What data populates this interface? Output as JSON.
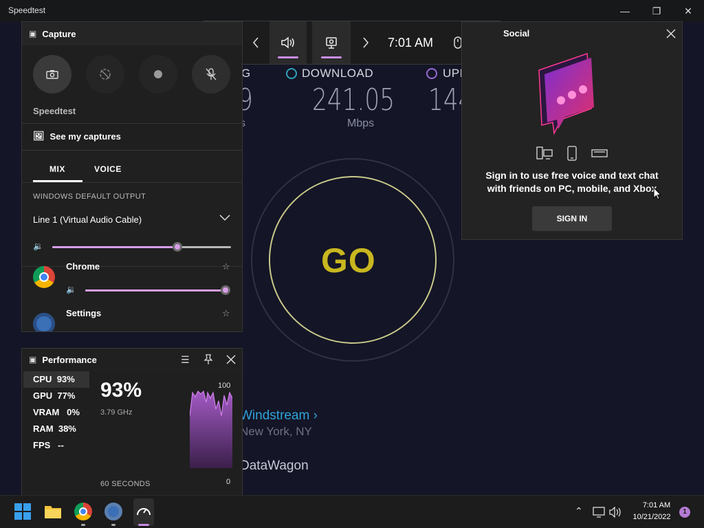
{
  "app": {
    "title": "Speedtest"
  },
  "speedtest": {
    "ping": {
      "label_partial": "G",
      "value_partial": "9",
      "unit_partial": "s"
    },
    "download": {
      "label": "DOWNLOAD",
      "value": "241.05",
      "unit": "Mbps"
    },
    "upload": {
      "label_partial": "UPL",
      "value_partial": "144"
    },
    "go_label": "GO",
    "isp": {
      "name": "Windstream",
      "location": "New York, NY",
      "server": "DataWagon"
    }
  },
  "gamebar": {
    "time": "7:01 AM"
  },
  "capture": {
    "title": "Capture",
    "app_name": "Speedtest",
    "see_captures": "See my captures"
  },
  "audio": {
    "tabs": [
      {
        "label": "MIX"
      },
      {
        "label": "VOICE"
      }
    ],
    "output_header": "WINDOWS DEFAULT OUTPUT",
    "output_device": "Line 1 (Virtual Audio Cable)",
    "master_volume": 0.7,
    "apps": [
      {
        "name": "Chrome",
        "volume": 1.0
      },
      {
        "name": "Settings"
      }
    ]
  },
  "performance": {
    "title": "Performance",
    "rows": [
      {
        "label": "CPU",
        "value": "93%"
      },
      {
        "label": "GPU",
        "value": "77%"
      },
      {
        "label": "VRAM",
        "value": "0%"
      },
      {
        "label": "RAM",
        "value": "38%"
      },
      {
        "label": "FPS",
        "value": "--"
      }
    ],
    "big_value": "93%",
    "freq": "3.79 GHz",
    "graph_max": "100",
    "graph_min": "0",
    "duration": "60 SECONDS"
  },
  "social": {
    "title": "Social",
    "message": "Sign in to use free voice and text chat with friends on PC, mobile, and Xbox",
    "sign_in": "SIGN IN"
  },
  "taskbar": {
    "time": "7:01 AM",
    "date": "10/21/2022",
    "notification_count": "1"
  },
  "colors": {
    "accent": "#c88de6",
    "go": "#c8b71f",
    "link": "#2fa3d8"
  }
}
